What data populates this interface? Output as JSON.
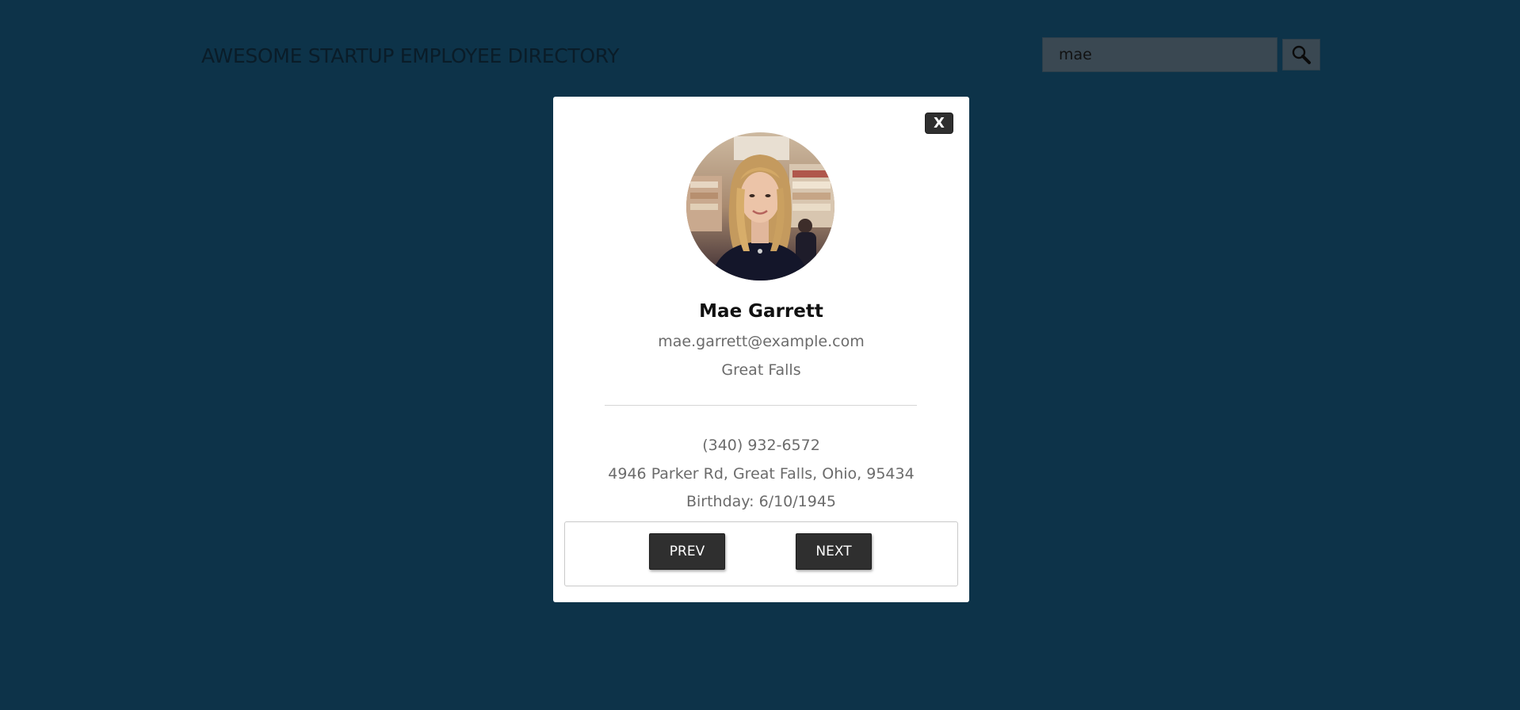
{
  "header": {
    "title": "AWESOME STARTUP EMPLOYEE DIRECTORY"
  },
  "search": {
    "value": "mae",
    "button_icon": "search-icon"
  },
  "modal": {
    "close_label": "X",
    "name": "Mae Garrett",
    "email": "mae.garrett@example.com",
    "city": "Great Falls",
    "phone": "(340) 932-6572",
    "address": "4946 Parker Rd, Great Falls, Ohio, 95434",
    "birthday": "Birthday: 6/10/1945",
    "prev_label": "PREV",
    "next_label": "NEXT"
  },
  "colors": {
    "background": "#0d3349",
    "title_text": "#0a1c28",
    "modal_background": "#ffffff",
    "button_background": "#2f2f2f",
    "muted_text": "#6b6b6b"
  }
}
